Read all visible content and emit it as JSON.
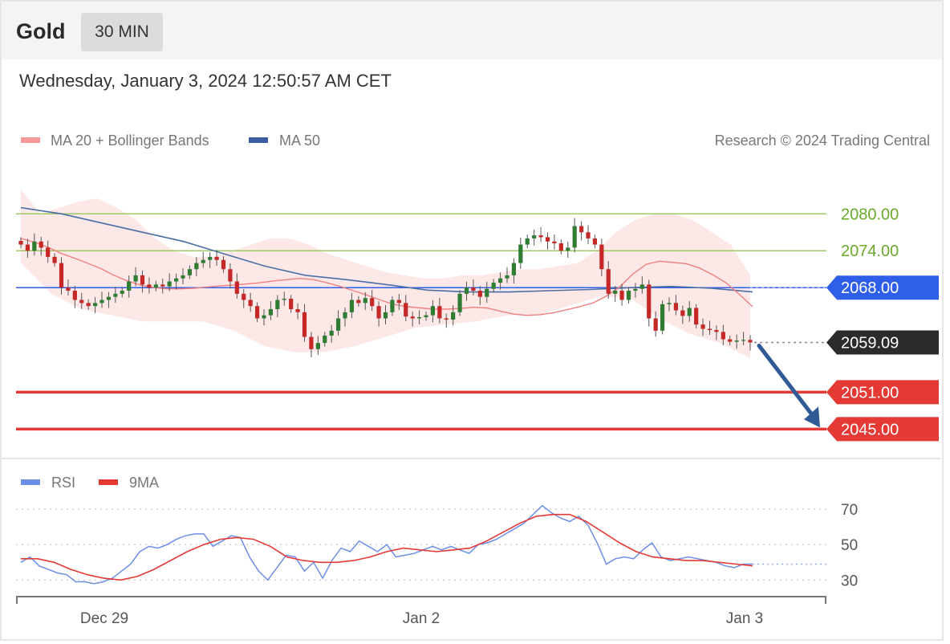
{
  "header": {
    "title": "Gold",
    "timeframe": "30 MIN"
  },
  "datetime": "Wednesday, January 3, 2024 12:50:57 AM CET",
  "legend": {
    "ma20": "MA 20 + Bollinger Bands",
    "ma50": "MA 50",
    "credit": "Research © 2024 Trading Central"
  },
  "rsi_legend": {
    "rsi": "RSI",
    "ma9": "9MA"
  },
  "colors": {
    "up": "#2e7d32",
    "down": "#c62828",
    "bband_fill": "#fde4e4",
    "ma20": "#f08080",
    "ma50": "#4a6fa5",
    "resistance": "#8bc34a",
    "pivot": "#2f5fe8",
    "support": "#e53935",
    "current": "#2b2b2b",
    "arrow": "#2f5a96",
    "rsi": "#6b8ee6",
    "rsi_ma": "#e53935"
  },
  "chart_data": [
    {
      "type": "candlestick",
      "title": "Gold",
      "timeframe": "30 MIN",
      "ylim": [
        2041,
        2088
      ],
      "x_ticks": [
        "Dec 29",
        "Jan 2",
        "Jan 3"
      ],
      "current_price": 2059.09,
      "levels": [
        {
          "label": "2080.00",
          "value": 2080.0,
          "kind": "resistance"
        },
        {
          "label": "2074.00",
          "value": 2074.0,
          "kind": "resistance"
        },
        {
          "label": "2068.00",
          "value": 2068.0,
          "kind": "pivot"
        },
        {
          "label": "2059.09",
          "value": 2059.09,
          "kind": "current"
        },
        {
          "label": "2051.00",
          "value": 2051.0,
          "kind": "support"
        },
        {
          "label": "2045.00",
          "value": 2045.0,
          "kind": "support"
        }
      ],
      "projection": {
        "from": 2059.09,
        "to": 2045.0,
        "direction": "down"
      },
      "closes": [
        2075,
        2074,
        2075.5,
        2074.5,
        2073,
        2072,
        2068,
        2067.5,
        2066,
        2065.5,
        2065,
        2065.5,
        2066,
        2066.5,
        2067,
        2067.5,
        2069,
        2070,
        2068.5,
        2068,
        2068.5,
        2068.2,
        2069,
        2069.5,
        2070,
        2071,
        2072,
        2072.5,
        2073,
        2072.5,
        2071,
        2069,
        2067,
        2066,
        2065,
        2063,
        2063.5,
        2064.5,
        2066,
        2066.2,
        2064.5,
        2064,
        2060,
        2058,
        2059,
        2060.2,
        2061,
        2063,
        2064,
        2066,
        2065.5,
        2066.3,
        2065,
        2063,
        2064,
        2066,
        2065.5,
        2063.3,
        2063,
        2063.2,
        2063.5,
        2065,
        2063,
        2062.8,
        2064,
        2067,
        2068,
        2067.5,
        2066.5,
        2067.8,
        2068.8,
        2069.5,
        2070,
        2072,
        2075,
        2076,
        2076.5,
        2076.2,
        2075.5,
        2075.2,
        2074,
        2074.5,
        2078,
        2077,
        2076,
        2075,
        2071,
        2067,
        2067.5,
        2066,
        2067.5,
        2067.8,
        2068.5,
        2063,
        2061,
        2065.3,
        2065.5,
        2064.3,
        2063.4,
        2064.7,
        2062,
        2061.3,
        2061.1,
        2060.8,
        2059.6,
        2059.2,
        2059.4,
        2059.5,
        2059.09
      ],
      "ma20": [
        2076,
        2075.4,
        2074.6,
        2073.6,
        2072.8,
        2072.0,
        2071.1,
        2070.0,
        2069.1,
        2068.4,
        2068.0,
        2067.8,
        2067.8,
        2067.9,
        2068.1,
        2068.3,
        2068.4,
        2068.6,
        2068.8,
        2069.1,
        2069.3,
        2069.5,
        2069.3,
        2068.8,
        2068.2,
        2067.5,
        2066.8,
        2066.0,
        2065.3,
        2064.9,
        2064.7,
        2064.5,
        2064.5,
        2064.6,
        2064.8,
        2064.7,
        2064.2,
        2063.7,
        2063.5,
        2063.6,
        2063.9,
        2064.4,
        2064.9,
        2065.5,
        2066.6,
        2068.1,
        2070.2,
        2071.8,
        2072.3,
        2072.1,
        2071.9,
        2071.2,
        2070.1,
        2068.8,
        2066.9,
        2064.9
      ],
      "bband_upper": [
        2084,
        2080,
        2081,
        2082,
        2082.5,
        2081,
        2079,
        2076,
        2074,
        2073,
        2073,
        2074,
        2075,
        2076,
        2076,
        2075,
        2073.5,
        2072.5,
        2071.5,
        2070.5,
        2070,
        2069.5,
        2069.5,
        2070,
        2070,
        2070.5,
        2071,
        2071,
        2071.5,
        2072,
        2074,
        2077,
        2079,
        2080,
        2080,
        2079,
        2077,
        2075,
        2070
      ],
      "bband_lower": [
        2072,
        2067,
        2064.5,
        2063.5,
        2062.5,
        2062.5,
        2062.5,
        2061,
        2058.5,
        2057.5,
        2057.5,
        2058.5,
        2060,
        2061.5,
        2062,
        2062.5,
        2063.5,
        2063.5,
        2065,
        2066.5,
        2066.5,
        2063,
        2060.5,
        2059,
        2056.5
      ],
      "ma50": [
        2081,
        2080,
        2078.5,
        2077,
        2075.5,
        2073.5,
        2071.5,
        2070,
        2069.3,
        2068.5,
        2067.6,
        2067.3,
        2067.3,
        2067.5,
        2067.7,
        2068,
        2068.2,
        2067.9,
        2067.3
      ]
    },
    {
      "type": "line",
      "title": "RSI",
      "ylim": [
        22,
        75
      ],
      "y_ticks": [
        30,
        50,
        70
      ],
      "series": [
        {
          "name": "RSI",
          "values": [
            40,
            43,
            38,
            36,
            34,
            33,
            29,
            29,
            28,
            29,
            31,
            35,
            39,
            46,
            49,
            48,
            50,
            53,
            55,
            56,
            56,
            49,
            52,
            55,
            54,
            43,
            35,
            30,
            37,
            44,
            43,
            35,
            40,
            31,
            41,
            48,
            46,
            52,
            49,
            46,
            50,
            43,
            44,
            45,
            47,
            49,
            47,
            49,
            47,
            45,
            50,
            51,
            53,
            56,
            59,
            62,
            67,
            72,
            68,
            65,
            63,
            66,
            61,
            51,
            39,
            42,
            43,
            42,
            47,
            51,
            43,
            41,
            42,
            43,
            42,
            41,
            40,
            38,
            37,
            39,
            39
          ]
        },
        {
          "name": "9MA",
          "values": [
            42,
            42,
            40,
            36,
            33,
            31,
            30,
            32,
            36,
            41,
            46,
            50,
            53,
            54,
            53,
            49,
            43,
            41,
            40,
            40,
            41,
            43,
            46,
            48,
            47,
            46,
            47,
            48,
            52,
            57,
            62,
            66,
            67,
            67,
            63,
            57,
            51,
            46,
            43,
            42,
            41,
            41,
            40,
            39,
            38
          ]
        }
      ]
    }
  ]
}
